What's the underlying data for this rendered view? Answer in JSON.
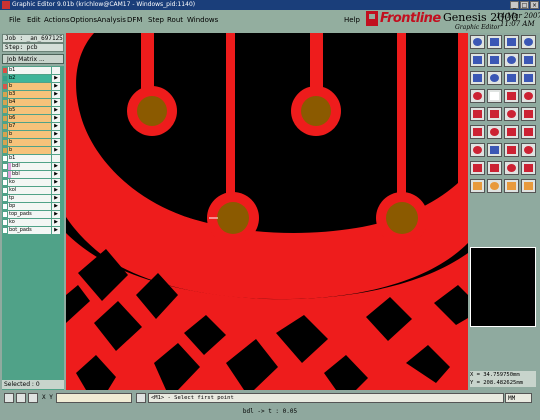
{
  "window": {
    "title": "Graphic Editor 9.01b (krichlow@CAM17 - Windows_pid:1140)"
  },
  "menu": [
    "File",
    "Edit",
    "Actions",
    "Options",
    "Analysis",
    "DFM",
    "Step",
    "Rout",
    "Windows"
  ],
  "help_label": "Help",
  "brand": {
    "logo_text": "Frontline",
    "product": "Genesis 2000",
    "subtitle": "Graphic Editor",
    "date": "14 Mar 2007",
    "time": "11:07 AM"
  },
  "left": {
    "job": "Job : _an_697125",
    "step": "Step: pcb",
    "matrix_button": "Job Matrix ...",
    "layers": [
      {
        "name": "b1",
        "arrow": ""
      },
      {
        "name": "b2",
        "arrow": "▶"
      },
      {
        "name": "b",
        "arrow": "▶"
      },
      {
        "name": "b3",
        "arrow": "▶"
      },
      {
        "name": "b4",
        "arrow": "▶"
      },
      {
        "name": "b5",
        "arrow": "▶"
      },
      {
        "name": "b6",
        "arrow": "▶"
      },
      {
        "name": "b7",
        "arrow": "▶"
      },
      {
        "name": "b",
        "arrow": "▶"
      },
      {
        "name": "b",
        "arrow": "▶"
      },
      {
        "name": "b",
        "arrow": "▶"
      },
      {
        "name": "b1",
        "arrow": ""
      },
      {
        "name": "bdl",
        "arrow": "▶"
      },
      {
        "name": "bbl",
        "arrow": "▶"
      },
      {
        "name": "ko",
        "arrow": "▶"
      },
      {
        "name": "kol",
        "arrow": "▶"
      },
      {
        "name": "tp",
        "arrow": "▶"
      },
      {
        "name": "bp",
        "arrow": "▶"
      },
      {
        "name": "top_pads",
        "arrow": "▶"
      },
      {
        "name": "ko",
        "arrow": "▶"
      },
      {
        "name": "bot_pads",
        "arrow": "▶"
      }
    ],
    "selected": "Selected : 0"
  },
  "right": {
    "coord_x": "X = 34.759750mm",
    "coord_y": "Y = 208.482625mm"
  },
  "bottom": {
    "xy_label": "X Y :",
    "prompt": "<M1> - Select first point",
    "unit": "MM",
    "status": "bdl -> t : 0.05"
  },
  "colors": {
    "copper": "#ee1c1c",
    "pad": "#8b5a00",
    "background": "#000000",
    "panel": "#8fa79f",
    "layer_list": "#50a288"
  }
}
